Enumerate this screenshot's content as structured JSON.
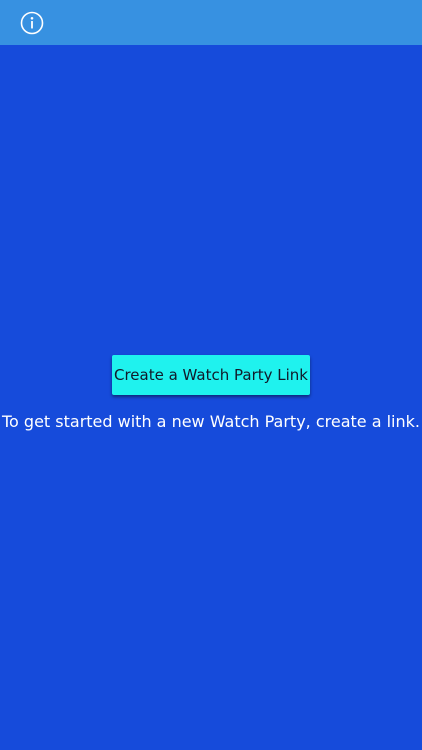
{
  "colors": {
    "background": "#164bdb",
    "top_bar": "#3791e1",
    "button_background": "#1ff2ee",
    "button_text": "#111a2a",
    "instructions_text": "#ffffff"
  },
  "header": {
    "info_icon": "info-circle-icon"
  },
  "main": {
    "create_button_label": "Create a Watch Party Link",
    "instructions": "To get started with a new Watch Party, create a link."
  }
}
